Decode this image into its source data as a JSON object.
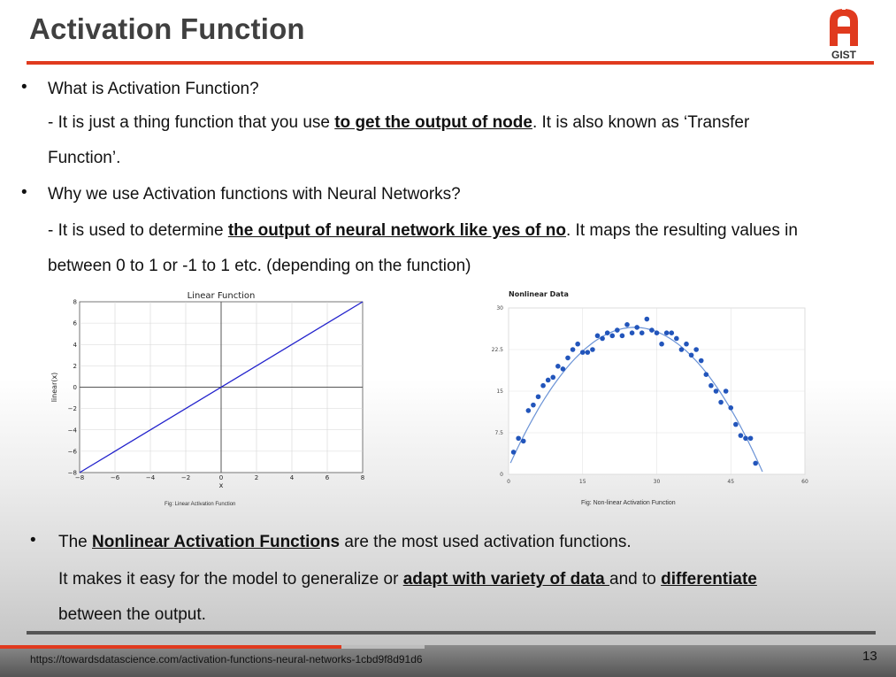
{
  "slide": {
    "title": "Activation Function",
    "logo_text": "GIST",
    "page_number": "13",
    "footer_url": "https://towardsdatascience.com/activation-functions-neural-networks-1cbd9f8d91d6",
    "accent_color": "#e03a1e"
  },
  "body": {
    "q1": "What is Activation Function?",
    "a1_pre": "- It is just a thing function that you use ",
    "a1_bold": "to get the output of node",
    "a1_post": ". It is also known as ‘Transfer",
    "a1_cont": "Function’.",
    "q2": "Why we use Activation functions with Neural Networks?",
    "a2_pre": "- It is used to determine ",
    "a2_bold": "the output of neural network like yes of no",
    "a2_post": ". It maps the resulting values in",
    "a2_cont": "between 0 to 1 or -1 to 1 etc. (depending on the function)",
    "p3_pre": "The ",
    "p3_bold": "Nonlinear Activation Functio",
    "p3_boldtail": "ns",
    "p3_post": " are the most used activation functions.",
    "p4_pre": "It makes it easy for the model to generalize or ",
    "p4_bold": "adapt with variety of data ",
    "p4_mid": "and to ",
    "p4_bold2": "differentiate",
    "p5": "between the output.",
    "bullet": "•"
  },
  "chart_data": [
    {
      "type": "line",
      "title": "Linear Function",
      "xlabel": "x",
      "ylabel": "linear(x)",
      "xlim": [
        -8,
        8
      ],
      "ylim": [
        -8,
        8
      ],
      "xticks": [
        -8,
        -6,
        -4,
        -2,
        0,
        2,
        4,
        6,
        8
      ],
      "yticks": [
        -8,
        -6,
        -4,
        -2,
        0,
        2,
        4,
        6,
        8
      ],
      "grid": true,
      "series": [
        {
          "x": [
            -8,
            8
          ],
          "y": [
            -8,
            8
          ],
          "color": "#2222cc"
        }
      ],
      "caption": "Fig: Linear Activation Function"
    },
    {
      "type": "scatter",
      "title": "Nonlinear Data",
      "xlim": [
        0,
        60
      ],
      "ylim": [
        0,
        30
      ],
      "xticks": [
        0,
        15,
        30,
        45,
        60
      ],
      "yticks": [
        0,
        7.5,
        15,
        22.5,
        30
      ],
      "yticklabels": [
        "0",
        "7.5",
        "15",
        "22.5",
        "30"
      ],
      "grid": true,
      "point_color": "#2255bb",
      "points": [
        [
          1,
          4
        ],
        [
          2,
          6.5
        ],
        [
          3,
          6
        ],
        [
          4,
          11.5
        ],
        [
          5,
          12.5
        ],
        [
          6,
          14
        ],
        [
          7,
          16
        ],
        [
          8,
          17
        ],
        [
          9,
          17.5
        ],
        [
          10,
          19.5
        ],
        [
          11,
          19
        ],
        [
          12,
          21
        ],
        [
          13,
          22.5
        ],
        [
          14,
          23.5
        ],
        [
          15,
          22
        ],
        [
          16,
          22
        ],
        [
          17,
          22.5
        ],
        [
          18,
          25
        ],
        [
          19,
          24.5
        ],
        [
          20,
          25.5
        ],
        [
          21,
          25
        ],
        [
          22,
          26
        ],
        [
          23,
          25
        ],
        [
          24,
          27
        ],
        [
          25,
          25.5
        ],
        [
          26,
          26.5
        ],
        [
          27,
          25.5
        ],
        [
          28,
          28
        ],
        [
          29,
          26
        ],
        [
          30,
          25.5
        ],
        [
          31,
          23.5
        ],
        [
          32,
          25.5
        ],
        [
          33,
          25.5
        ],
        [
          34,
          24.5
        ],
        [
          35,
          22.5
        ],
        [
          36,
          23.5
        ],
        [
          37,
          21.5
        ],
        [
          38,
          22.5
        ],
        [
          39,
          20.5
        ],
        [
          40,
          18
        ],
        [
          41,
          16
        ],
        [
          42,
          15
        ],
        [
          43,
          13
        ],
        [
          44,
          15
        ],
        [
          45,
          12
        ],
        [
          46,
          9
        ],
        [
          47,
          7
        ],
        [
          48,
          6.5
        ],
        [
          49,
          6.5
        ],
        [
          50,
          2
        ]
      ],
      "fit_curve": {
        "type": "quadratic",
        "peak_x": 25.5,
        "peak_y": 26.5,
        "a": -0.0388
      },
      "caption": "Fig: Non-linear Activation Function"
    }
  ]
}
